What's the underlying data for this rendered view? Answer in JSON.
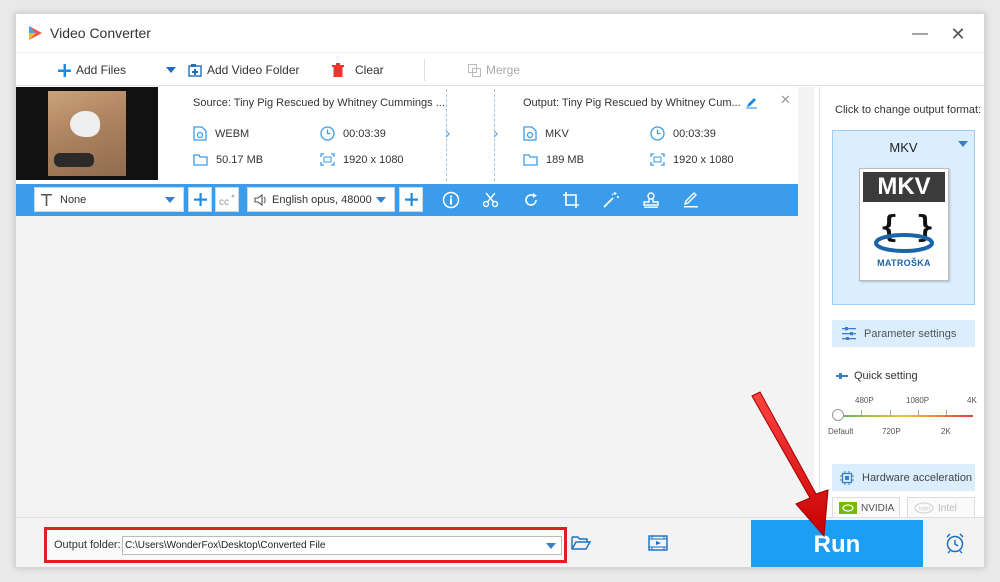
{
  "window": {
    "title": "Video Converter"
  },
  "toolbar": {
    "add_files": "Add Files",
    "add_video_folder": "Add Video Folder",
    "clear": "Clear",
    "merge": "Merge"
  },
  "file": {
    "source_title": "Source: Tiny Pig Rescued by Whitney Cummings ...",
    "source_format": "WEBM",
    "source_duration": "00:03:39",
    "source_size": "50.17 MB",
    "source_resolution": "1920 x 1080",
    "output_title": "Output: Tiny Pig Rescued by Whitney Cum...",
    "output_format": "MKV",
    "output_duration": "00:03:39",
    "output_size": "189 MB",
    "output_resolution": "1920 x 1080"
  },
  "edit_bar": {
    "subtitle_value": "None",
    "audio_value": "English opus, 48000"
  },
  "right_panel": {
    "change_format_label": "Click to change output format:",
    "format_name": "MKV",
    "format_doc_header": "MKV",
    "format_doc_sub": "MATROŠKA",
    "parameter_settings": "Parameter settings",
    "quick_setting": "Quick setting",
    "res_top": [
      "480P",
      "1080P",
      "4K"
    ],
    "res_bottom": [
      "Default",
      "720P",
      "2K"
    ],
    "quick_setting_level": "Default",
    "hardware_acceleration": "Hardware acceleration",
    "nvidia": "NVIDIA",
    "intel": "Intel"
  },
  "bottom": {
    "output_folder_label": "Output folder:",
    "output_folder_path": "C:\\Users\\WonderFox\\Desktop\\Converted File",
    "run_label": "Run"
  },
  "colors": {
    "accent": "#3a9cea",
    "run": "#1c9ef3",
    "highlight": "#e02020",
    "panel_bg": "#dbeefe"
  }
}
